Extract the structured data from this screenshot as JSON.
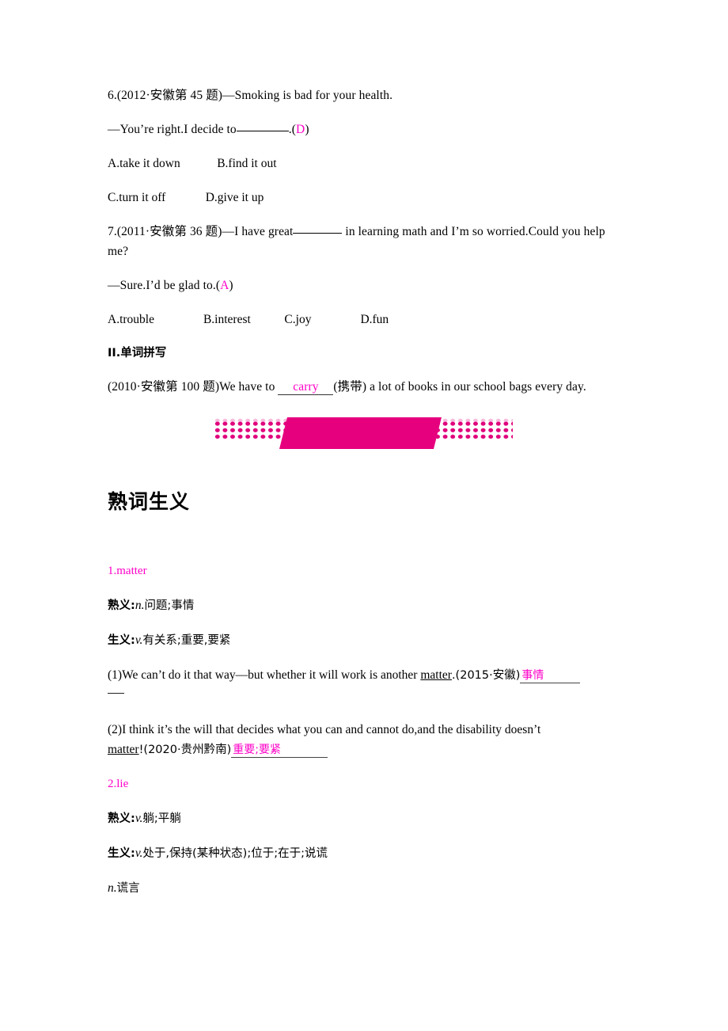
{
  "document": {
    "exercises": [
      {
        "id": "q6",
        "stem": "6.(2012·安徽第 45 题)—Smoking is bad for your health.",
        "response_prefix": "—You’re right.I decide to",
        "response_suffix": ".(",
        "response_end": ")",
        "answer_key": "D",
        "options_row1": "A.take it down            B.find it out",
        "options_row2": "C.turn it off             D.give it up"
      },
      {
        "id": "q7",
        "stem_prefix": "7.(2011·安徽第 36 题)—I have great",
        "stem_suffix": " in learning math and I’m so worried.Could you help me?",
        "response_prefix": "—Sure.I’d be glad to.(",
        "response_end": ")",
        "answer_key": "A",
        "options_row1": "A.trouble                B.interest           C.joy                D.fun"
      }
    ],
    "section_spelling": {
      "heading": "II.单词拼写",
      "prefix": "(2010·安徽第 100 题)We have to",
      "answer": "carry",
      "suffix": "(携带) a lot of books in our school bags every day."
    },
    "banner": {
      "name": "decorative-banner",
      "color": "#e6007e",
      "dot_color": "#e0007c"
    },
    "chapter": {
      "title": "熟词生义"
    },
    "entries": [
      {
        "index": "1.matter",
        "familiar_label": "熟义:",
        "familiar_pos": "n.",
        "familiar_meaning": "问题;事情",
        "new_label": "生义:",
        "new_pos": "v.",
        "new_meaning": "有关系;重要,要紧",
        "examples": [
          {
            "number": "(1)",
            "text_before": "We can’t do it that way—but whether it will work is another ",
            "keyword": "matter",
            "text_after": ".(2015·安徽)",
            "answer": "事情",
            "wrapped": true
          },
          {
            "number": "(2)",
            "text_line1": "I think it’s the will that decides what you can and cannot do,and the disability doesn’t",
            "keyword": "matter",
            "text_after": "!(2020·贵州黔南)",
            "answer": "重要;要紧",
            "wrapped": false
          }
        ]
      },
      {
        "index": "2.lie",
        "familiar_label": "熟义:",
        "familiar_pos": "v.",
        "familiar_meaning": "躺;平躺",
        "new_label": "生义:",
        "new_pos": "v.",
        "new_meaning": "处于,保持(某种状态);位于;在于;说谎",
        "extra_pos": "n.",
        "extra_meaning": "谎言",
        "examples": []
      }
    ]
  }
}
